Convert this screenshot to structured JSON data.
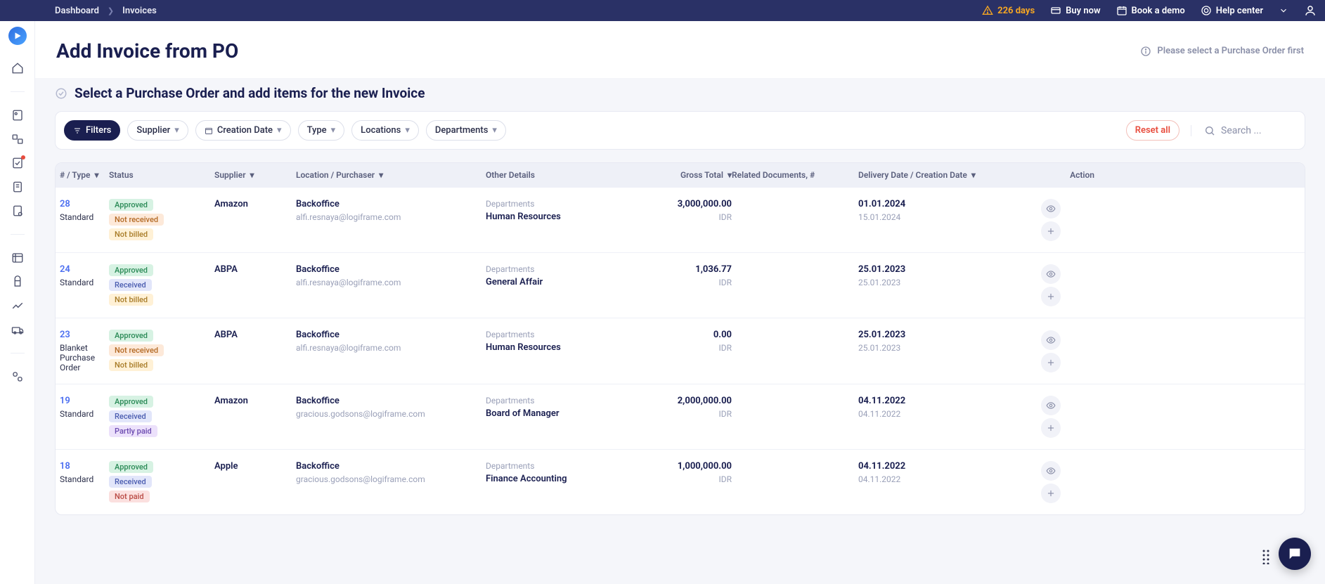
{
  "breadcrumb": {
    "a": "Dashboard",
    "b": "Invoices"
  },
  "topbar": {
    "days": "226 days",
    "buy": "Buy now",
    "demo": "Book a demo",
    "help": "Help center"
  },
  "page": {
    "title": "Add Invoice from PO",
    "hint": "Please select a Purchase Order first",
    "section": "Select a Purchase Order and add items for the new Invoice"
  },
  "toolbar": {
    "filters": "Filters",
    "supplier": "Supplier",
    "creation": "Creation Date",
    "type": "Type",
    "locations": "Locations",
    "departments": "Departments",
    "reset": "Reset all",
    "search_ph": "Search ..."
  },
  "cols": {
    "numtype": "# / Type",
    "status": "Status",
    "supplier": "Supplier",
    "location": "Location / Purchaser",
    "other": "Other Details",
    "gross": "Gross Total",
    "related": "Related Documents, #",
    "delivery": "Delivery Date / Creation Date",
    "action": "Action"
  },
  "labels": {
    "departments": "Departments"
  },
  "rows": [
    {
      "num": "28",
      "type": "Standard",
      "supplier": "Amazon",
      "loc": "Backoffice",
      "email": "alfi.resnaya@logiframe.com",
      "dept": "Human Resources",
      "amount": "3,000,000.00",
      "currency": "IDR",
      "d1": "01.01.2024",
      "d2": "15.01.2024",
      "badges": [
        "Approved",
        "Not received",
        "Not billed"
      ]
    },
    {
      "num": "24",
      "type": "Standard",
      "supplier": "ABPA",
      "loc": "Backoffice",
      "email": "alfi.resnaya@logiframe.com",
      "dept": "General Affair",
      "amount": "1,036.77",
      "currency": "IDR",
      "d1": "25.01.2023",
      "d2": "25.01.2023",
      "badges": [
        "Approved",
        "Received",
        "Not billed"
      ]
    },
    {
      "num": "23",
      "type": "Blanket Purchase Order",
      "supplier": "ABPA",
      "loc": "Backoffice",
      "email": "alfi.resnaya@logiframe.com",
      "dept": "Human Resources",
      "amount": "0.00",
      "currency": "IDR",
      "d1": "25.01.2023",
      "d2": "25.01.2023",
      "badges": [
        "Approved",
        "Not received",
        "Not billed"
      ]
    },
    {
      "num": "19",
      "type": "Standard",
      "supplier": "Amazon",
      "loc": "Backoffice",
      "email": "gracious.godsons@logiframe.com",
      "dept": "Board of Manager",
      "amount": "2,000,000.00",
      "currency": "IDR",
      "d1": "04.11.2022",
      "d2": "04.11.2022",
      "badges": [
        "Approved",
        "Received",
        "Partly paid"
      ]
    },
    {
      "num": "18",
      "type": "Standard",
      "supplier": "Apple",
      "loc": "Backoffice",
      "email": "gracious.godsons@logiframe.com",
      "dept": "Finance Accounting",
      "amount": "1,000,000.00",
      "currency": "IDR",
      "d1": "04.11.2022",
      "d2": "04.11.2022",
      "badges": [
        "Approved",
        "Received",
        "Not paid"
      ]
    }
  ]
}
